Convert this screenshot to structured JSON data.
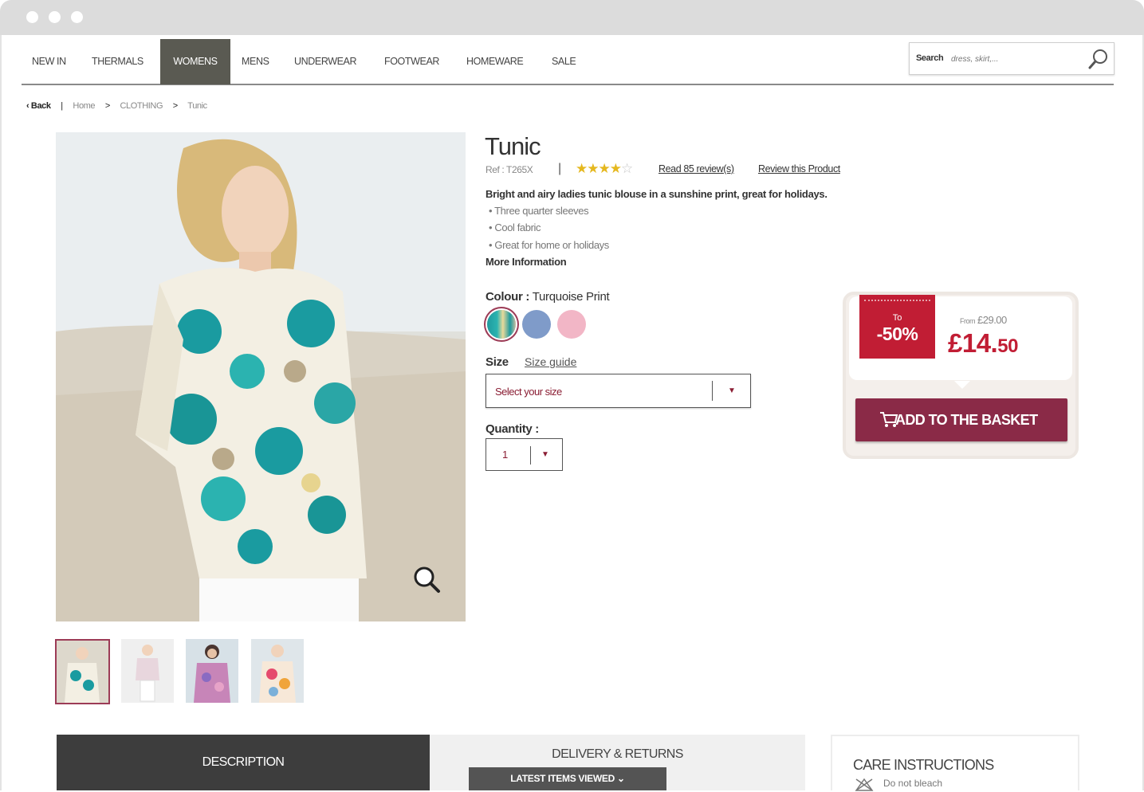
{
  "window": {
    "dots": 3
  },
  "nav": {
    "items": [
      {
        "label": "NEW IN"
      },
      {
        "label": "THERMALS"
      },
      {
        "label": "WOMENS",
        "active": true
      },
      {
        "label": "MENS"
      },
      {
        "label": "UNDERWEAR"
      },
      {
        "label": "FOOTWEAR"
      },
      {
        "label": "HOMEWARE"
      },
      {
        "label": "SALE"
      }
    ]
  },
  "search": {
    "label": "Search",
    "placeholder": "dress, skirt,...",
    "icon": "search-icon"
  },
  "breadcrumb": {
    "back": "‹ Back",
    "home": "Home",
    "category": "CLOTHING",
    "current": "Tunic"
  },
  "product": {
    "title": "Tunic",
    "ref": "Ref : T265X",
    "rating": 4,
    "rating_max": 5,
    "reviews_link": "Read 85 review(s)",
    "review_link": "Review this Product",
    "description": "Bright and airy ladies tunic blouse in a sunshine print, great for holidays.",
    "bullets": [
      "Three quarter sleeves",
      "Cool fabric",
      "Great for home or holidays"
    ],
    "more_info": "More Information",
    "colour_label": "Colour :",
    "colour_value": "Turquoise Print",
    "swatches": [
      {
        "name": "turquoise-print",
        "color": "#1f9a9e"
      },
      {
        "name": "blue",
        "color": "#7f9bc9"
      },
      {
        "name": "pink",
        "color": "#f2b6c6"
      }
    ],
    "size_label": "Size",
    "size_guide": "Size guide",
    "size_placeholder": "Select your size",
    "quantity_label": "Quantity :",
    "quantity_value": "1"
  },
  "price": {
    "discount_to": "To",
    "discount_pct": "-50%",
    "from_label": "From",
    "was": "£29.00",
    "now_main": "£14.",
    "now_pence": "50",
    "add_button": "ADD TO THE BASKET",
    "accent": "#c11d34",
    "button_color": "#8a2a47"
  },
  "tabs": {
    "description": "DESCRIPTION",
    "delivery": "DELIVERY & RETURNS",
    "latest": "LATEST ITEMS VIEWED",
    "care_title": "CARE INSTRUCTIONS",
    "care_item": "Do not bleach"
  }
}
